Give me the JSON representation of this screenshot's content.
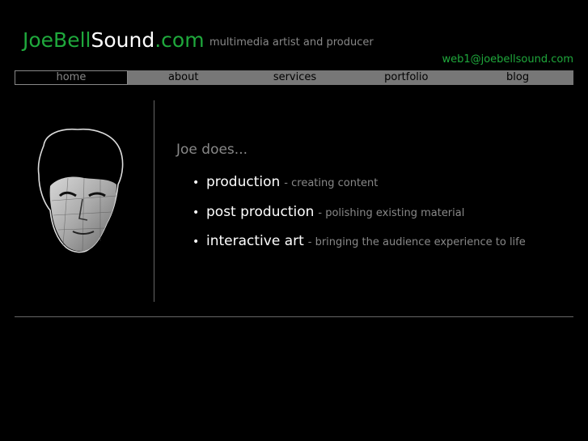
{
  "header": {
    "logo": {
      "part1": "JoeBell",
      "part2": "Sound",
      "part3": ".com"
    },
    "tagline": "multimedia artist and producer",
    "email": "web1@joebellsound.com"
  },
  "nav": {
    "items": [
      {
        "label": "home",
        "active": true
      },
      {
        "label": "about"
      },
      {
        "label": "services"
      },
      {
        "label": "portfolio"
      },
      {
        "label": "blog"
      }
    ]
  },
  "main": {
    "heading": "Joe does...",
    "bullet": "•",
    "items": [
      {
        "title": "production",
        "desc": "- creating content"
      },
      {
        "title": "post production",
        "desc": "- polishing existing material"
      },
      {
        "title": "interactive art",
        "desc": "- bringing the audience experience to life"
      }
    ]
  },
  "colors": {
    "brand_green": "#1fa83c",
    "nav_bg": "#777777",
    "background": "#000000",
    "muted_text": "#888888"
  }
}
